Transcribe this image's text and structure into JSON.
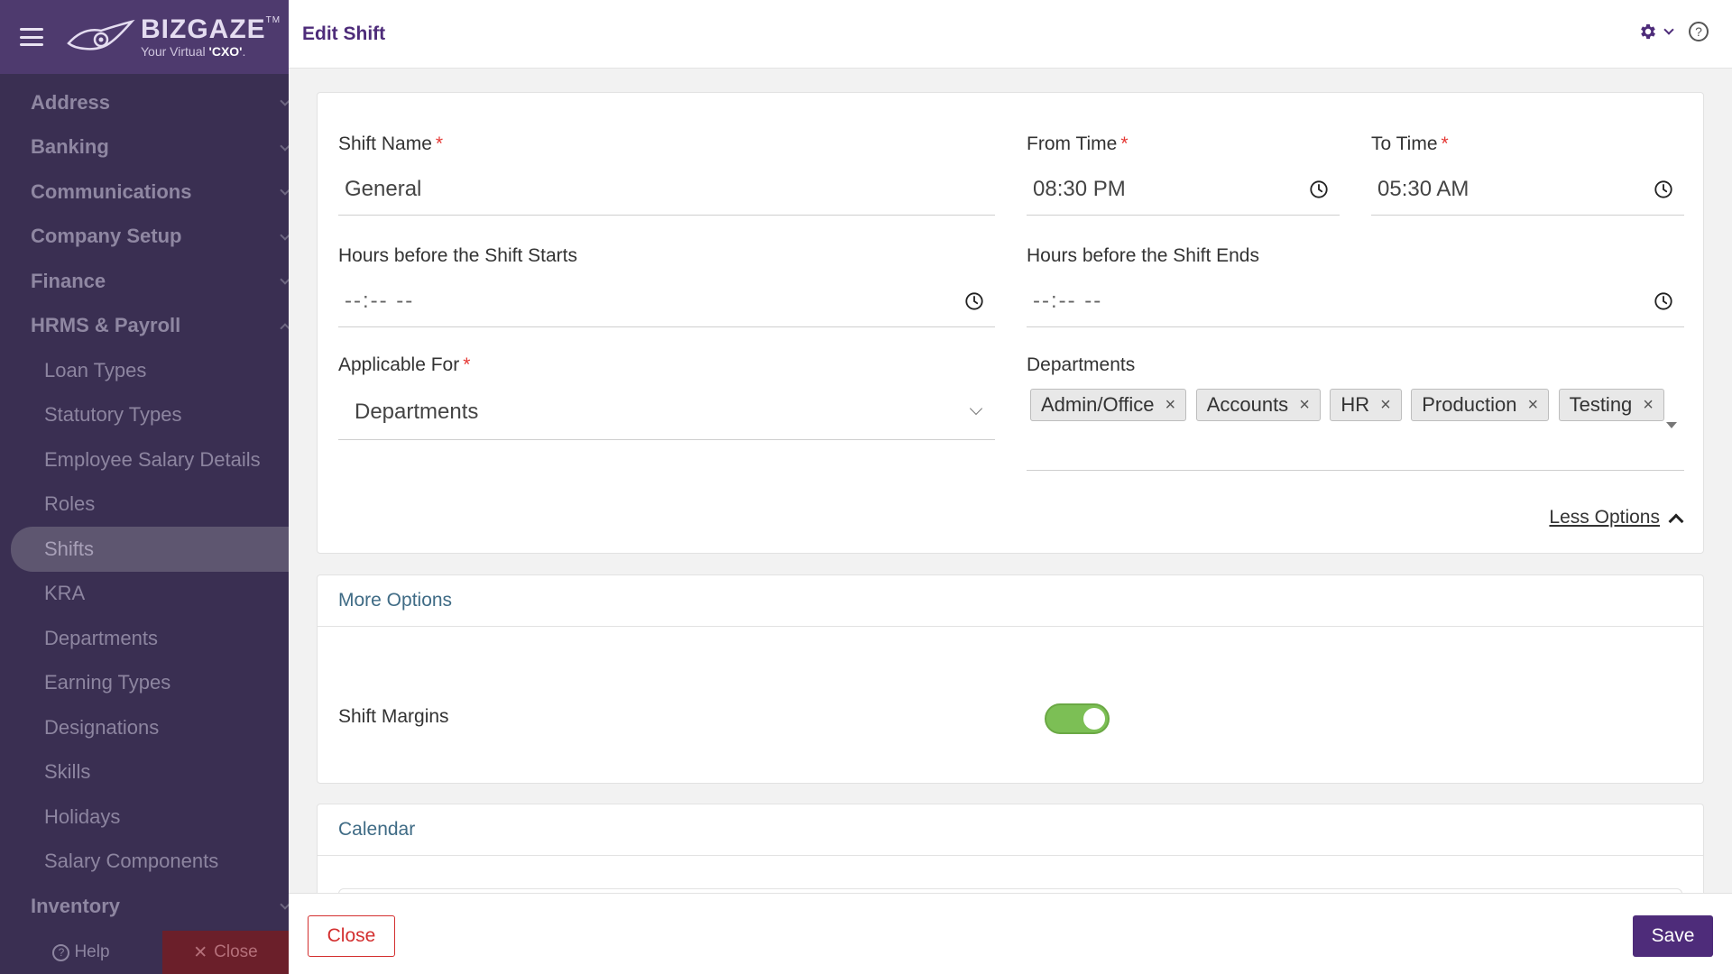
{
  "app": {
    "brand": "BIZGAZE",
    "brand_tm": "TM",
    "tagline_prefix": "Your Virtual ",
    "tagline_highlight": "'CXO'",
    "tagline_suffix": "."
  },
  "sidebar": {
    "items": [
      {
        "label": "Address",
        "level": "top",
        "chevron": "down"
      },
      {
        "label": "Banking",
        "level": "top",
        "chevron": "down"
      },
      {
        "label": "Communications",
        "level": "top",
        "chevron": "down"
      },
      {
        "label": "Company Setup",
        "level": "top",
        "chevron": "down"
      },
      {
        "label": "Finance",
        "level": "top",
        "chevron": "down"
      },
      {
        "label": "HRMS & Payroll",
        "level": "top",
        "chevron": "up"
      },
      {
        "label": "Loan Types",
        "level": "sub"
      },
      {
        "label": "Statutory Types",
        "level": "sub"
      },
      {
        "label": "Employee Salary Details",
        "level": "sub"
      },
      {
        "label": "Roles",
        "level": "sub"
      },
      {
        "label": "Shifts",
        "level": "sub",
        "active": true
      },
      {
        "label": "KRA",
        "level": "sub"
      },
      {
        "label": "Departments",
        "level": "sub"
      },
      {
        "label": "Earning Types",
        "level": "sub"
      },
      {
        "label": "Designations",
        "level": "sub"
      },
      {
        "label": "Skills",
        "level": "sub"
      },
      {
        "label": "Holidays",
        "level": "sub"
      },
      {
        "label": "Salary Components",
        "level": "sub"
      },
      {
        "label": "Inventory",
        "level": "top",
        "chevron": "down"
      }
    ],
    "help_label": "Help",
    "close_label": "Close"
  },
  "header": {
    "title": "Edit Shift"
  },
  "form": {
    "shift_name": {
      "label": "Shift Name",
      "value": "General",
      "required": true
    },
    "from_time": {
      "label": "From Time",
      "value": "08:30 PM",
      "required": true
    },
    "to_time": {
      "label": "To Time",
      "value": "05:30 AM",
      "required": true
    },
    "hours_before_start": {
      "label": "Hours before the Shift Starts",
      "value": "--:-- --"
    },
    "hours_before_end": {
      "label": "Hours before the Shift Ends",
      "value": "--:-- --"
    },
    "applicable_for": {
      "label": "Applicable For",
      "value": "Departments",
      "required": true
    },
    "departments": {
      "label": "Departments",
      "tags": [
        "Admin/Office",
        "Accounts",
        "HR",
        "Production",
        "Testing"
      ]
    },
    "less_options_label": "Less Options",
    "required_marker": "*",
    "tag_remove": "×"
  },
  "more_options": {
    "title": "More Options",
    "shift_margins_label": "Shift Margins",
    "shift_margins_on": true
  },
  "calendar": {
    "title": "Calendar"
  },
  "footer": {
    "close_label": "Close",
    "save_label": "Save"
  },
  "colors": {
    "brand": "#4e2c7a",
    "sidebar_bg": "#3a2f52",
    "toggle_on": "#7cbf55",
    "danger": "#d32f2f",
    "section_title": "#3f6b85"
  },
  "icons": {
    "menu": "hamburger-icon",
    "settings": "gear-icon",
    "help": "question-icon",
    "time": "clock-icon"
  }
}
